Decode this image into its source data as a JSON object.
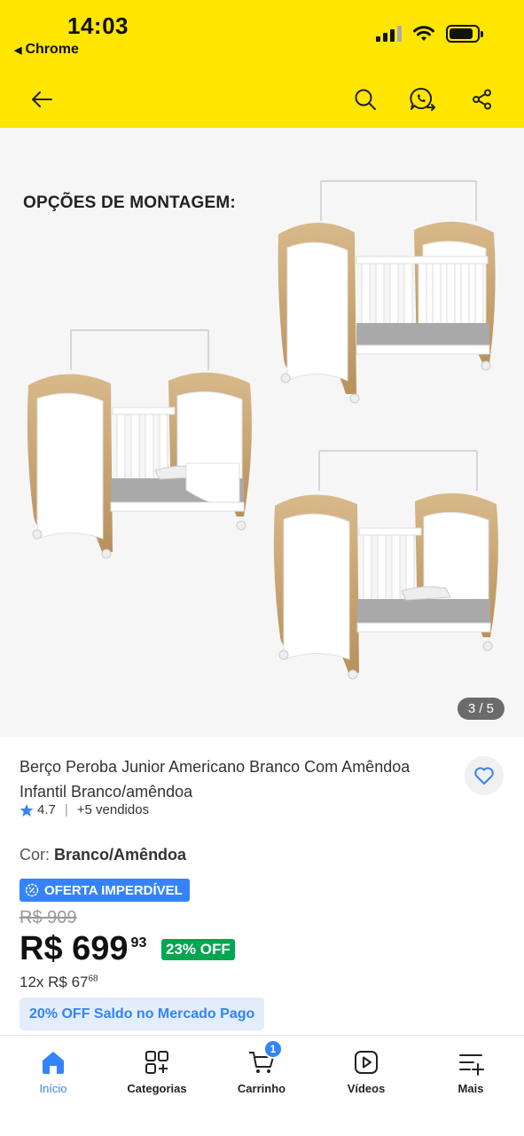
{
  "status_bar": {
    "time": "14:03",
    "back_app": "Chrome"
  },
  "header": {
    "back_icon": "arrow-left-icon",
    "search_icon": "search-icon",
    "whatsapp_icon": "whatsapp-share-icon",
    "share_icon": "share-icon",
    "background_color": "#ffe600"
  },
  "gallery": {
    "heading": "OPÇÕES DE MONTAGEM:",
    "counter": "3 / 5"
  },
  "product": {
    "title": "Berço Peroba Junior Americano Branco Com Amêndoa Infantil Branco/amêndoa",
    "rating": "4.7",
    "sold": "+5 vendidos",
    "color_label": "Cor:",
    "color_value": "Branco/Amêndoa",
    "deal_badge": "OFERTA IMPERDÍVEL",
    "old_price": "R$ 909",
    "price_main": "R$ 699",
    "price_cents": "93",
    "discount": "23% OFF",
    "installments_prefix": "12x R$ 67",
    "installments_cents": "68",
    "promo": "20% OFF Saldo no Mercado Pago"
  },
  "bottom_nav": {
    "items": [
      {
        "label": "Início",
        "icon": "home-icon",
        "active": true
      },
      {
        "label": "Categorias",
        "icon": "categories-icon"
      },
      {
        "label": "Carrinho",
        "icon": "cart-icon",
        "badge": "1"
      },
      {
        "label": "Vídeos",
        "icon": "video-icon"
      },
      {
        "label": "Mais",
        "icon": "more-icon"
      }
    ]
  },
  "colors": {
    "accent": "#3483fa",
    "discount_green": "#00a650",
    "wood": "#c8a677"
  }
}
